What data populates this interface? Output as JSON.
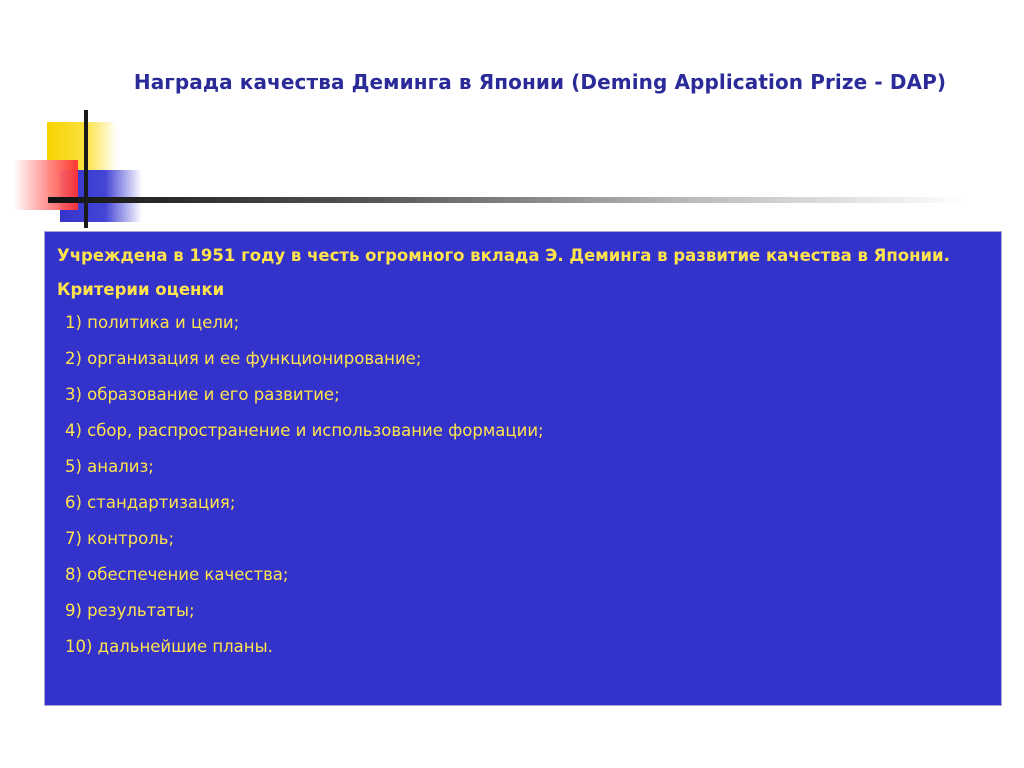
{
  "slide": {
    "title": "Награда качества Деминга в Японии (Deming Application Prize - DAP)",
    "intro": "Учреждена в 1951 году в честь огромного вклада Э. Деминга в развитие качества в Японии.",
    "criteria_heading": "Критерии оценки",
    "criteria": [
      "1) политика и цели;",
      "2) организация и ее функционирование;",
      "3) образование и его развитие;",
      "4) сбор, распространение и использование формации;",
      "5) анализ;",
      "6) стандартизация;",
      "7) контроль;",
      "8) обеспечение качества;",
      "9) результаты;",
      "10) дальнейшие планы."
    ]
  },
  "colors": {
    "title": "#2a2a99",
    "panel_background": "#3333cc",
    "panel_text": "#ffe34d",
    "accent_yellow": "#f7d200",
    "accent_blue": "#3434cc",
    "accent_red": "#ff3030"
  }
}
